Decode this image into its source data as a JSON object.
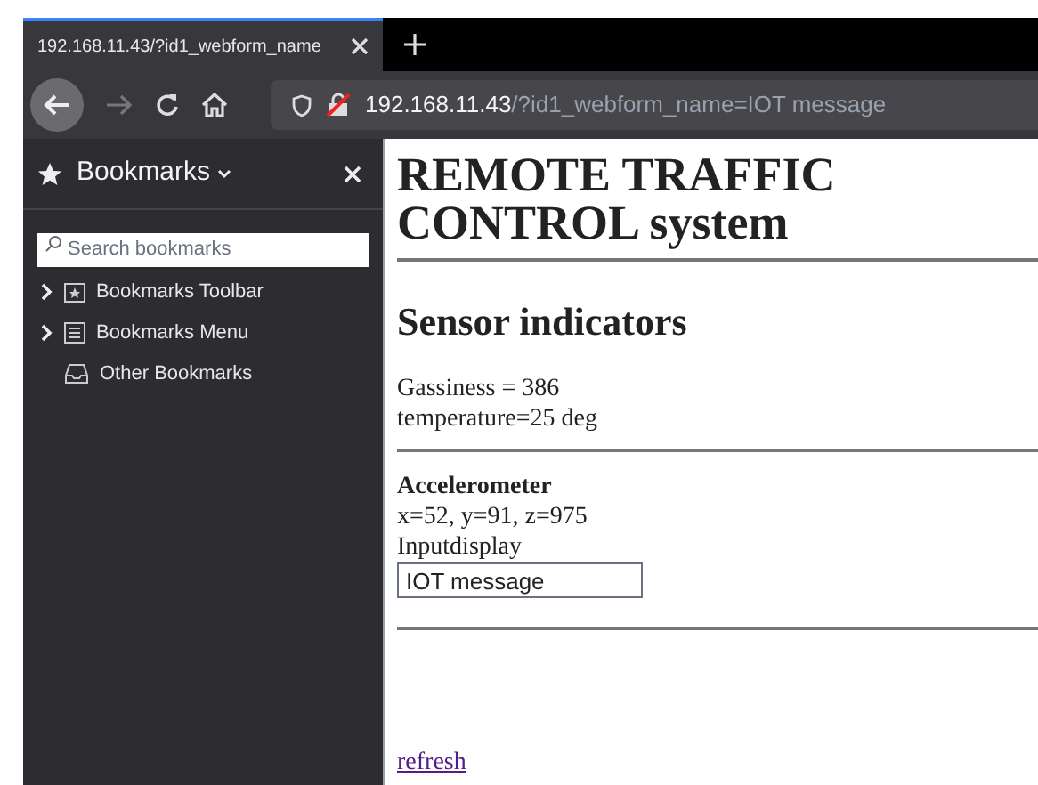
{
  "tab": {
    "title": "192.168.11.43/?id1_webform_name",
    "selected": true
  },
  "address_bar": {
    "host": "192.168.11.43",
    "path": "/?id1_webform_name=IOT message"
  },
  "sidebar": {
    "title": "Bookmarks",
    "search": {
      "placeholder": "Search bookmarks"
    },
    "items": [
      {
        "label": "Bookmarks Toolbar",
        "kind": "toolbar",
        "expanded": false
      },
      {
        "label": "Bookmarks Menu",
        "kind": "menu",
        "expanded": false
      },
      {
        "label": "Other Bookmarks",
        "kind": "other"
      }
    ]
  },
  "page": {
    "title_lines": [
      "REMOTE TRAFFIC",
      "CONTROL system"
    ],
    "section_heading": "Sensor indicators",
    "readings": [
      "Gassiness = 386",
      "temperature=25 deg"
    ],
    "accelerometer": {
      "heading": "Accelerometer",
      "values": "x=52, y=91, z=975"
    },
    "input": {
      "label": "Inputdisplay",
      "value": "IOT message"
    },
    "link": "refresh"
  }
}
